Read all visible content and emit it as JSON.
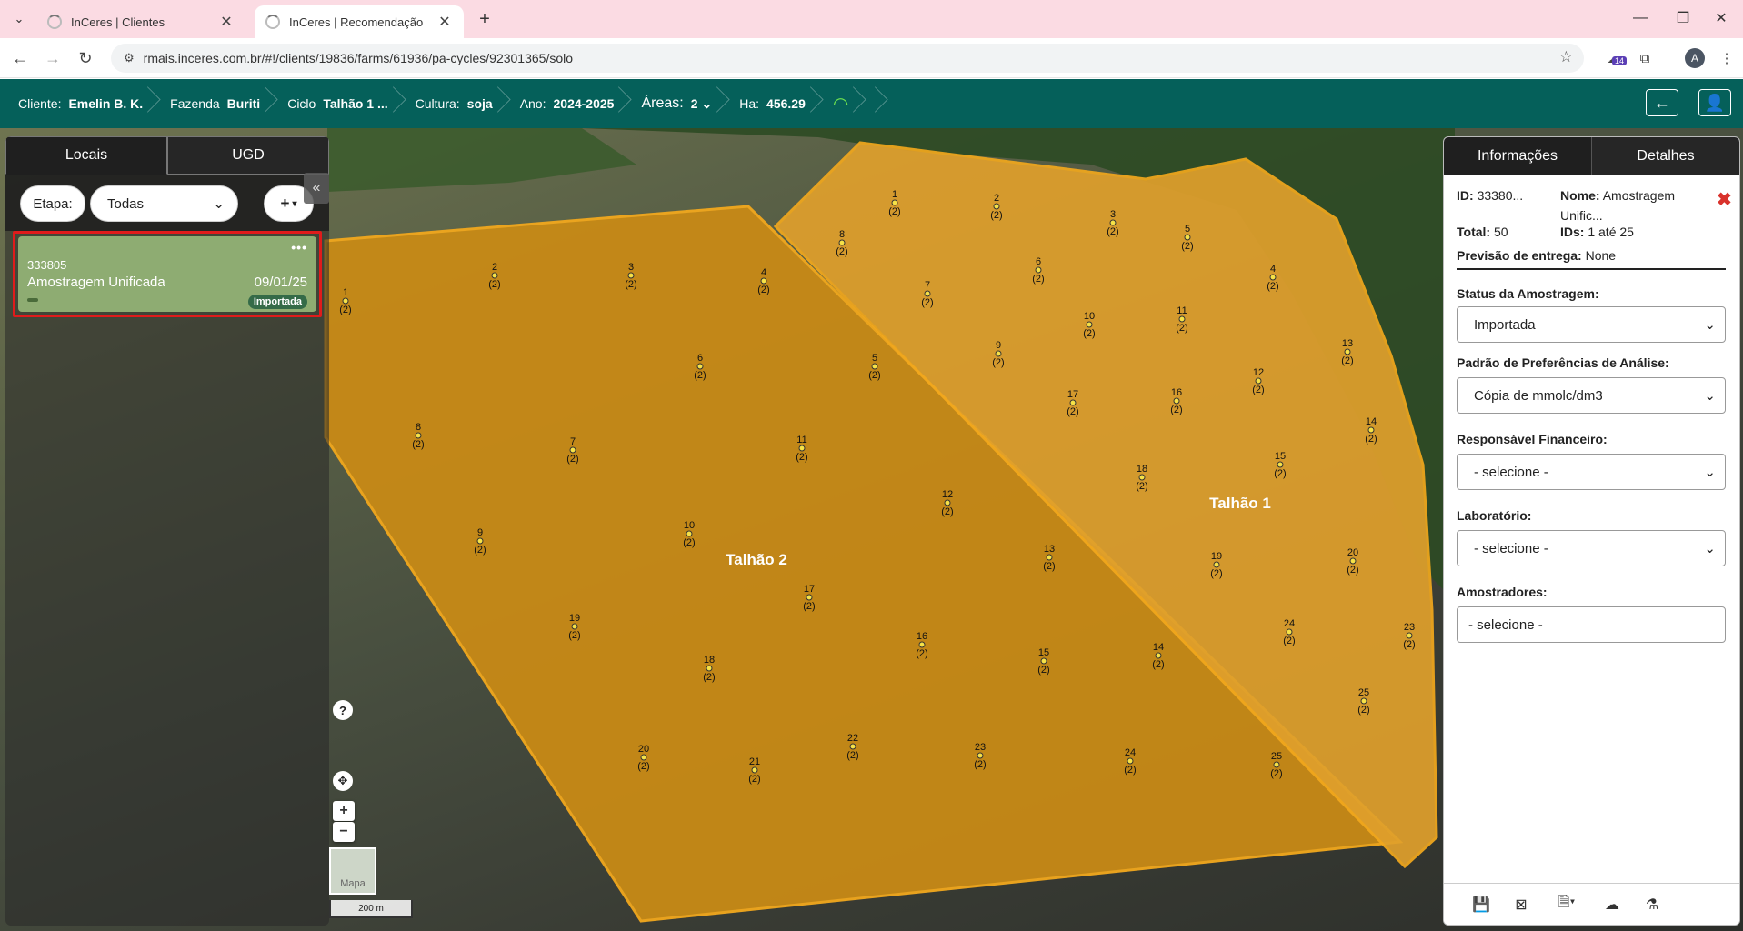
{
  "browser": {
    "tabs": [
      {
        "title": "InCeres | Clientes"
      },
      {
        "title": "InCeres | Recomendação"
      }
    ],
    "url": "rmais.inceres.com.br/#!/clients/19836/farms/61936/pa-cycles/92301365/solo",
    "extension_badge": "14",
    "profile_initial": "A"
  },
  "header": {
    "crumbs": [
      {
        "label": "Cliente:",
        "value": "Emelin B. K."
      },
      {
        "label": "Fazenda",
        "value": "Buriti"
      },
      {
        "label": "Ciclo",
        "value": "Talhão 1 ..."
      },
      {
        "label": "Cultura:",
        "value": "soja"
      },
      {
        "label": "Ano:",
        "value": "2024-2025"
      },
      {
        "label": "Áreas:",
        "value": "2"
      },
      {
        "label": "Ha:",
        "value": "456.29"
      }
    ]
  },
  "left_panel": {
    "tabs": [
      "Locais",
      "UGD"
    ],
    "etapa_label": "Etapa:",
    "etapa_value": "Todas",
    "add_label": "+",
    "card": {
      "id": "333805",
      "name": "Amostragem Unificada",
      "date": "09/01/25",
      "status": "Importada",
      "menu": "•••"
    }
  },
  "right_panel": {
    "tabs": [
      "Informações",
      "Detalhes"
    ],
    "id_label": "ID:",
    "id_value": "33380...",
    "nome_label": "Nome:",
    "nome_value_1": "Amostragem",
    "nome_value_2": "Unific...",
    "total_label": "Total:",
    "total_value": "50",
    "ids_label": "IDs:",
    "ids_value": "1 até 25",
    "previsao_label": "Previsão de entrega:",
    "previsao_value": "None",
    "fields": [
      {
        "label": "Status da Amostragem:",
        "value": "Importada"
      },
      {
        "label": "Padrão de Preferências de Análise:",
        "value": "Cópia de mmolc/dm3"
      },
      {
        "label": "Responsável Financeiro:",
        "value": "- selecione -"
      },
      {
        "label": "Laboratório:",
        "value": "- selecione -"
      },
      {
        "label": "Amostradores:",
        "value": "- selecione -"
      }
    ]
  },
  "map": {
    "talhao_labels": [
      "Talhão 2",
      "Talhão 1"
    ],
    "basemap_label": "Mapa",
    "scale_label": "200 m",
    "help": "?",
    "zoom_in": "+",
    "zoom_out": "−",
    "point_sublabel": "(2)",
    "talhao2_points": [
      "1",
      "2",
      "3",
      "4",
      "5",
      "6",
      "7",
      "8",
      "9",
      "10",
      "11",
      "12",
      "13",
      "14",
      "15",
      "16",
      "17",
      "18",
      "19",
      "20",
      "21",
      "22",
      "23",
      "24",
      "25"
    ],
    "talhao1_points": [
      "1",
      "2",
      "3",
      "4",
      "5",
      "6",
      "7",
      "8",
      "9",
      "10",
      "11",
      "12",
      "13",
      "14",
      "15",
      "16",
      "17",
      "18",
      "19",
      "20",
      "23",
      "24",
      "25"
    ],
    "colors": {
      "field_fill": "#e8a023",
      "field_border": "#f2a81d"
    }
  }
}
